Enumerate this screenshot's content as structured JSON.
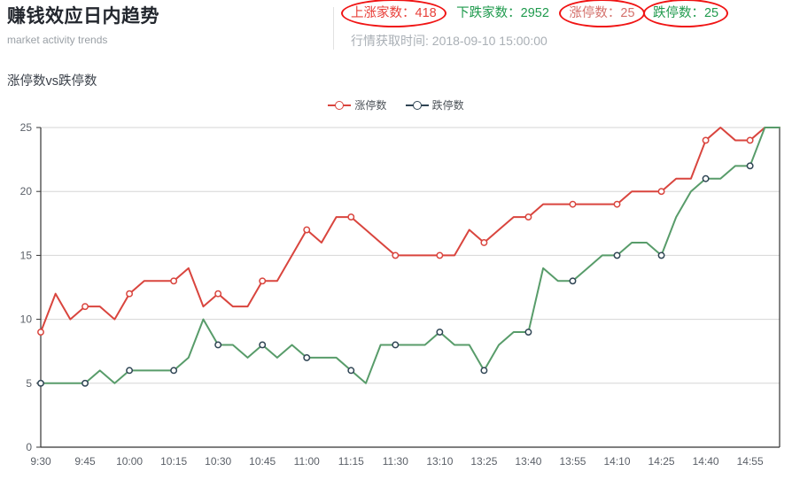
{
  "header": {
    "title": "赚钱效应日内趋势",
    "subtitle": "market activity trends",
    "stats": [
      {
        "label": "上涨家数：418",
        "name": "stat-advancing",
        "circled": true
      },
      {
        "label": "下跌家数：2952",
        "name": "stat-declining",
        "circled": false
      },
      {
        "label": "涨停数：25",
        "name": "stat-limit-up",
        "circled": true
      },
      {
        "label": "跌停数：25",
        "name": "stat-limit-down",
        "circled": true
      }
    ],
    "timestamp": "行情获取时间: 2018-09-10 15:00:00"
  },
  "chart": {
    "title": "涨停数vs跌停数",
    "legend": [
      {
        "label": "涨停数",
        "color": "#d9453e"
      },
      {
        "label": "跌停数",
        "color": "#2f4554"
      }
    ]
  },
  "colors": {
    "limit_up_line": "#d9453e",
    "limit_down_line": "#589c6a",
    "marker_up_stroke": "#d9453e",
    "marker_down_stroke": "#2f4554",
    "grid": "#d6d6d6",
    "axis": "#333333",
    "stat_red": "#e8403a",
    "stat_green": "#1f9a4d",
    "stat_pink": "#d4706b",
    "ellipse": "#f01414"
  },
  "chart_data": {
    "type": "line",
    "title": "涨停数vs跌停数",
    "xlabel": "",
    "ylabel": "",
    "ylim": [
      0,
      25
    ],
    "yticks": [
      0,
      5,
      10,
      15,
      20,
      25
    ],
    "grid": true,
    "legend_position": "top-center",
    "x": [
      "9:30",
      "9:35",
      "9:40",
      "9:45",
      "9:50",
      "9:55",
      "10:00",
      "10:05",
      "10:10",
      "10:15",
      "10:20",
      "10:25",
      "10:30",
      "10:35",
      "10:40",
      "10:45",
      "10:50",
      "10:55",
      "11:00",
      "11:05",
      "11:10",
      "11:15",
      "11:20",
      "11:25",
      "11:30",
      "13:00",
      "13:05",
      "13:10",
      "13:15",
      "13:20",
      "13:25",
      "13:30",
      "13:35",
      "13:40",
      "13:45",
      "13:50",
      "13:55",
      "14:00",
      "14:05",
      "14:10",
      "14:15",
      "14:20",
      "14:25",
      "14:30",
      "14:35",
      "14:40",
      "14:45",
      "14:50",
      "14:55",
      "15:00"
    ],
    "tick_labels": [
      "9:30",
      "9:45",
      "10:00",
      "10:15",
      "10:30",
      "10:45",
      "11:00",
      "11:15",
      "11:30",
      "13:10",
      "13:25",
      "13:40",
      "13:55",
      "14:10",
      "14:25",
      "14:40",
      "14:55"
    ],
    "tick_indices": [
      0,
      3,
      6,
      9,
      12,
      15,
      18,
      21,
      24,
      27,
      30,
      33,
      36,
      39,
      42,
      45,
      48
    ],
    "series": [
      {
        "name": "涨停数",
        "color": "#d9453e",
        "values": [
          9,
          12,
          10,
          11,
          11,
          10,
          12,
          13,
          13,
          13,
          14,
          11,
          12,
          11,
          11,
          13,
          13,
          15,
          17,
          16,
          18,
          18,
          17,
          16,
          15,
          15,
          15,
          15,
          15,
          17,
          16,
          17,
          18,
          18,
          19,
          19,
          19,
          19,
          19,
          19,
          20,
          20,
          20,
          21,
          21,
          24,
          25,
          24,
          24,
          25,
          25
        ]
      },
      {
        "name": "跌停数",
        "color": "#589c6a",
        "values": [
          5,
          5,
          5,
          5,
          6,
          5,
          6,
          6,
          6,
          6,
          7,
          10,
          8,
          8,
          7,
          8,
          7,
          8,
          7,
          7,
          7,
          6,
          5,
          8,
          8,
          8,
          8,
          9,
          8,
          8,
          6,
          8,
          9,
          9,
          14,
          13,
          13,
          14,
          15,
          15,
          16,
          16,
          15,
          18,
          20,
          21,
          21,
          22,
          22,
          25,
          25
        ]
      }
    ]
  }
}
